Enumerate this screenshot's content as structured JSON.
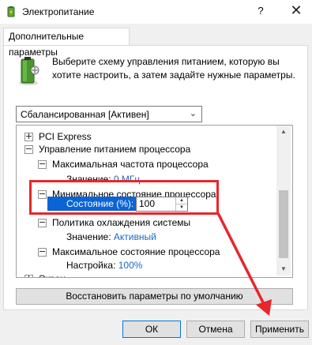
{
  "window": {
    "title": "Электропитание",
    "help_label": "?",
    "close_label": "✕"
  },
  "tabs": [
    {
      "label": "Дополнительные параметры"
    }
  ],
  "intro_text": "Выберите схему управления питанием, которую вы хотите настроить, а затем задайте нужные параметры.",
  "scheme_select": {
    "value": "Сбалансированная [Активен]"
  },
  "tree": {
    "rows": [
      {
        "label": "PCI Express",
        "expander": "plus"
      },
      {
        "label": "Управление питанием процессора",
        "expander": "minus"
      },
      {
        "label": "Максимальная частота процессора",
        "expander": "minus"
      },
      {
        "prefix": "Значение:",
        "value": "0 МГц"
      },
      {
        "label": "Минимальное состояние процессора",
        "expander": "minus"
      },
      {
        "prefix": "Состояние (%):",
        "value": "100"
      },
      {
        "label": "Политика охлаждения системы",
        "expander": "minus"
      },
      {
        "prefix": "Значение:",
        "value": "Активный"
      },
      {
        "label": "Максимальное состояние процессора",
        "expander": "minus"
      },
      {
        "prefix": "Настройка:",
        "value": "100%"
      },
      {
        "label": "Экран",
        "expander": "plus"
      }
    ]
  },
  "restore_defaults_label": "Восстановить параметры по умолчанию",
  "buttons": {
    "ok": "ОК",
    "cancel": "Отмена",
    "apply": "Применить"
  },
  "colors": {
    "highlight_red": "#e8262b",
    "selection_blue": "#0a64d6",
    "link_blue": "#1a69c7"
  }
}
